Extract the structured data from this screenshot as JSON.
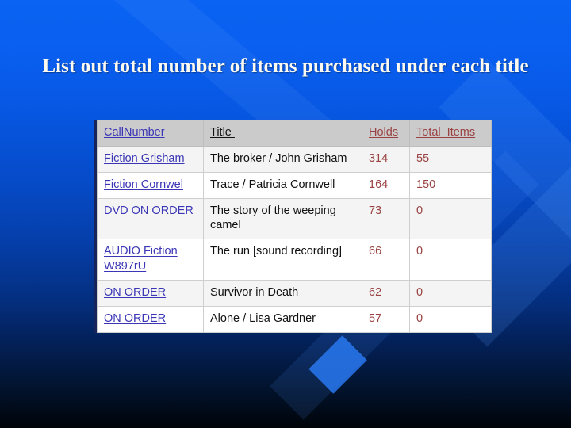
{
  "slide": {
    "title": "List out total number of items purchased under each title",
    "background_top_color": "#0a63f2",
    "background_bottom_color": "#000408",
    "title_color": "#fdfbf0"
  },
  "table": {
    "header_background": "#cbcbcb",
    "link_color": "#3b36b5",
    "number_color": "#9a4242",
    "columns": [
      {
        "key": "call",
        "label": "CallNumber",
        "color": "#3b36b5"
      },
      {
        "key": "title",
        "label": "Title ",
        "color": "#101010"
      },
      {
        "key": "holds",
        "label": "Holds",
        "color": "#9a4242"
      },
      {
        "key": "total",
        "label": "Total  Items",
        "color": "#9a4242"
      }
    ],
    "rows": [
      {
        "call": "Fiction Grisham",
        "title": "The broker / John Grisham",
        "holds": "314",
        "total": "55"
      },
      {
        "call": "Fiction Cornwel",
        "title": "Trace / Patricia Cornwell",
        "holds": "164",
        "total": "150"
      },
      {
        "call": "DVD ON ORDER",
        "title": "The story of the weeping camel",
        "holds": "73",
        "total": "0"
      },
      {
        "call": "AUDIO Fiction W897rU",
        "title": "The run [sound recording]",
        "holds": "66",
        "total": "0"
      },
      {
        "call": "ON ORDER",
        "title": "Survivor in Death",
        "holds": "62",
        "total": "0"
      },
      {
        "call": "ON ORDER",
        "title": "Alone / Lisa Gardner",
        "holds": "57",
        "total": "0"
      }
    ]
  }
}
